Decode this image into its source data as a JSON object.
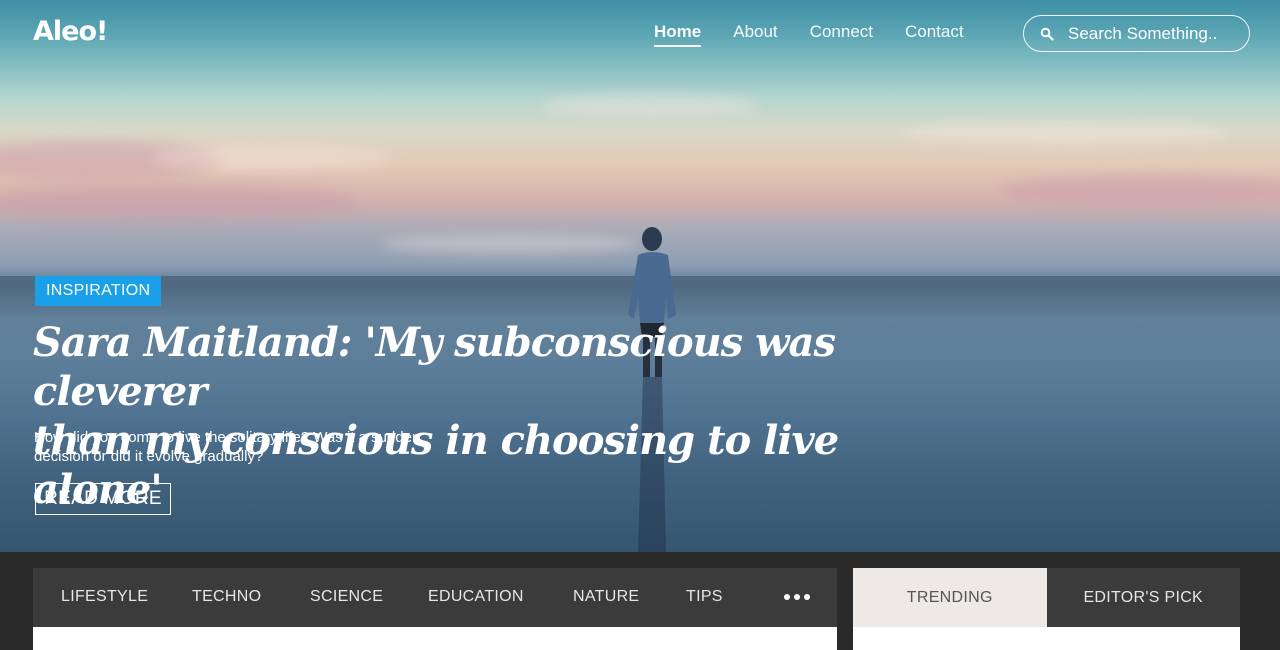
{
  "brand": {
    "logo": "Aleo!"
  },
  "nav": {
    "items": [
      {
        "label": "Home",
        "active": true
      },
      {
        "label": "About"
      },
      {
        "label": "Connect"
      },
      {
        "label": "Contact"
      }
    ]
  },
  "search": {
    "placeholder": "Search Something..",
    "icon": "search-icon"
  },
  "hero": {
    "category": "INSPIRATION",
    "title_line1": "Sara Maitland: 'My subconscious was cleverer",
    "title_line2": "than my conscious in choosing to live alone'",
    "excerpt": "How did you come to live the solitary life? Was it a sudden decision or did it evolve gradually?",
    "read_more": "READ MORE"
  },
  "categories": {
    "items": [
      "LIFESTYLE",
      "TECHNO",
      "SCIENCE",
      "EDUCATION",
      "NATURE",
      "TIPS"
    ],
    "more_icon": "more-dots-icon"
  },
  "side_tabs": {
    "trending": "TRENDING",
    "editors_pick": "EDITOR'S PICK"
  },
  "colors": {
    "accent": "#1aa0e8",
    "bar_dark": "#3b3b3b",
    "tab_active": "#ece9e6"
  }
}
